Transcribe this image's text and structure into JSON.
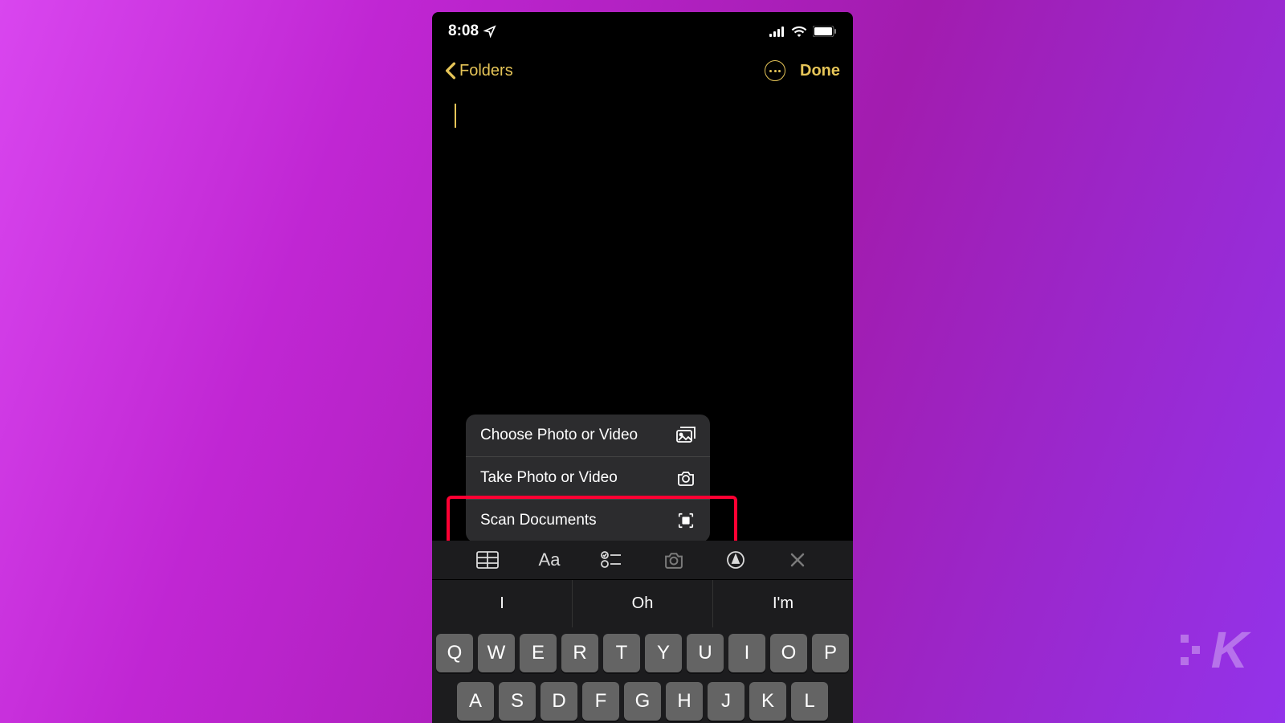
{
  "status": {
    "time": "8:08",
    "location_arrow": "location-icon",
    "signal": "signal-icon",
    "wifi": "wifi-icon",
    "battery": "battery-icon"
  },
  "nav": {
    "back_label": "Folders",
    "done_label": "Done"
  },
  "popup": {
    "items": [
      {
        "label": "Choose Photo or Video",
        "icon": "photo-library-icon"
      },
      {
        "label": "Take Photo or Video",
        "icon": "camera-icon"
      },
      {
        "label": "Scan Documents",
        "icon": "scan-icon"
      }
    ],
    "highlighted_index": 2
  },
  "toolbar": {
    "table": "table-icon",
    "text_format": "Aa",
    "checklist": "checklist-icon",
    "camera": "camera-icon",
    "markup": "markup-icon",
    "close": "close-icon"
  },
  "suggestions": [
    "I",
    "Oh",
    "I'm"
  ],
  "keyboard": {
    "row1": [
      "Q",
      "W",
      "E",
      "R",
      "T",
      "Y",
      "U",
      "I",
      "O",
      "P"
    ],
    "row2": [
      "A",
      "S",
      "D",
      "F",
      "G",
      "H",
      "J",
      "K",
      "L"
    ]
  },
  "watermark": "K"
}
